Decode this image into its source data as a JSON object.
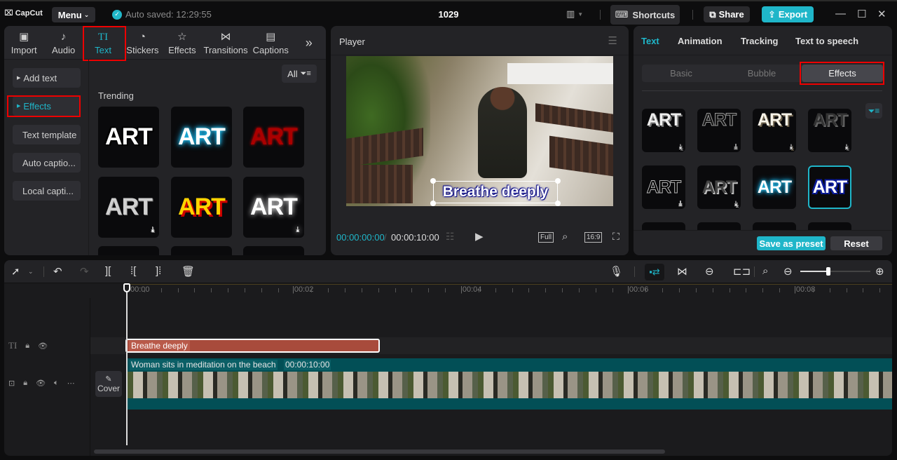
{
  "app": {
    "logo": "CapCut",
    "menu_label": "Menu",
    "autosave": "Auto saved: 12:29:55",
    "project_title": "1029",
    "shortcuts_label": "Shortcuts",
    "share_label": "Share",
    "export_label": "Export",
    "accent": "#1fb6c9"
  },
  "media_tabs": [
    {
      "label": "Import",
      "icon": "import-icon"
    },
    {
      "label": "Audio",
      "icon": "audio-icon"
    },
    {
      "label": "Text",
      "icon": "text-icon",
      "active": true
    },
    {
      "label": "Stickers",
      "icon": "sticker-icon"
    },
    {
      "label": "Effects",
      "icon": "effects-icon"
    },
    {
      "label": "Transitions",
      "icon": "transitions-icon"
    },
    {
      "label": "Captions",
      "icon": "captions-icon"
    }
  ],
  "text_sidebar": [
    {
      "label": "Add text",
      "arrow": true
    },
    {
      "label": "Effects",
      "arrow": true,
      "active": true
    },
    {
      "label": "Text template"
    },
    {
      "label": "Auto captio..."
    },
    {
      "label": "Local capti..."
    }
  ],
  "filter_label": "All",
  "trending_label": "Trending",
  "trending_tiles": [
    {
      "text": "ART",
      "style": "white-outline"
    },
    {
      "text": "ART",
      "style": "cyan-glow"
    },
    {
      "text": "ART",
      "style": "red-grunge"
    },
    {
      "text": "ART",
      "style": "silver-gradient",
      "download": true
    },
    {
      "text": "ART",
      "style": "yellow-red-shadow"
    },
    {
      "text": "ART",
      "style": "white-glow",
      "download": true
    }
  ],
  "player": {
    "title": "Player",
    "caption": "Breathe deeply",
    "current_time": "00:00:00:00",
    "separator": "/",
    "total_time": "00:00:10:00",
    "full_label": "Full",
    "ratio_label": "16:9"
  },
  "inspector": {
    "tabs": [
      {
        "label": "Text",
        "active": true
      },
      {
        "label": "Animation"
      },
      {
        "label": "Tracking"
      },
      {
        "label": "Text to speech"
      }
    ],
    "segments": [
      {
        "label": "Basic"
      },
      {
        "label": "Bubble"
      },
      {
        "label": "Effects",
        "active": true
      }
    ],
    "effects": [
      {
        "text": "ART",
        "style": "white-3d",
        "download": true
      },
      {
        "text": "ART",
        "style": "dark-outline",
        "download": true
      },
      {
        "text": "ART",
        "style": "cream-3d",
        "download": true
      },
      {
        "text": "ART",
        "style": "grey-3d",
        "download": true
      },
      {
        "text": "ART",
        "style": "black-outline",
        "download": true
      },
      {
        "text": "ART",
        "style": "grey-shadow",
        "download": true
      },
      {
        "text": "ART",
        "style": "cyan-glow"
      },
      {
        "text": "ART",
        "style": "blue-outline",
        "selected": true
      }
    ],
    "save_preset_label": "Save as preset",
    "reset_label": "Reset"
  },
  "timeline": {
    "ticks": [
      "00:00",
      "|00:02",
      "|00:04",
      "|00:06",
      "|00:08"
    ],
    "zoom_level": 0.4,
    "text_clip": "Breathe deeply",
    "video_clip": {
      "name": "Woman sits in meditation on the beach",
      "duration": "00:00:10:00"
    },
    "cover_label": "Cover"
  }
}
